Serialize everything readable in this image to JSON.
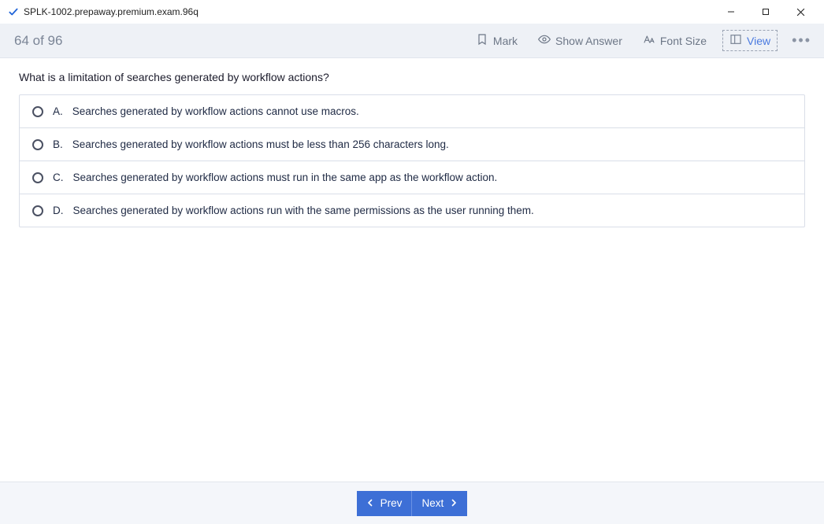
{
  "window": {
    "title": "SPLK-1002.prepaway.premium.exam.96q"
  },
  "toolbar": {
    "progress": "64 of 96",
    "mark": "Mark",
    "show_answer": "Show Answer",
    "font_size": "Font Size",
    "view": "View"
  },
  "question": {
    "stem": "What is a limitation of searches generated by workflow actions?",
    "options": [
      {
        "letter": "A.",
        "text": "Searches generated by workflow actions cannot use macros."
      },
      {
        "letter": "B.",
        "text": "Searches generated by workflow actions must be less than 256 characters long."
      },
      {
        "letter": "C.",
        "text": "Searches generated by workflow actions must run in the same app as the workflow action."
      },
      {
        "letter": "D.",
        "text": "Searches generated by workflow actions run with the same permissions as the user running them."
      }
    ]
  },
  "footer": {
    "prev": "Prev",
    "next": "Next"
  }
}
